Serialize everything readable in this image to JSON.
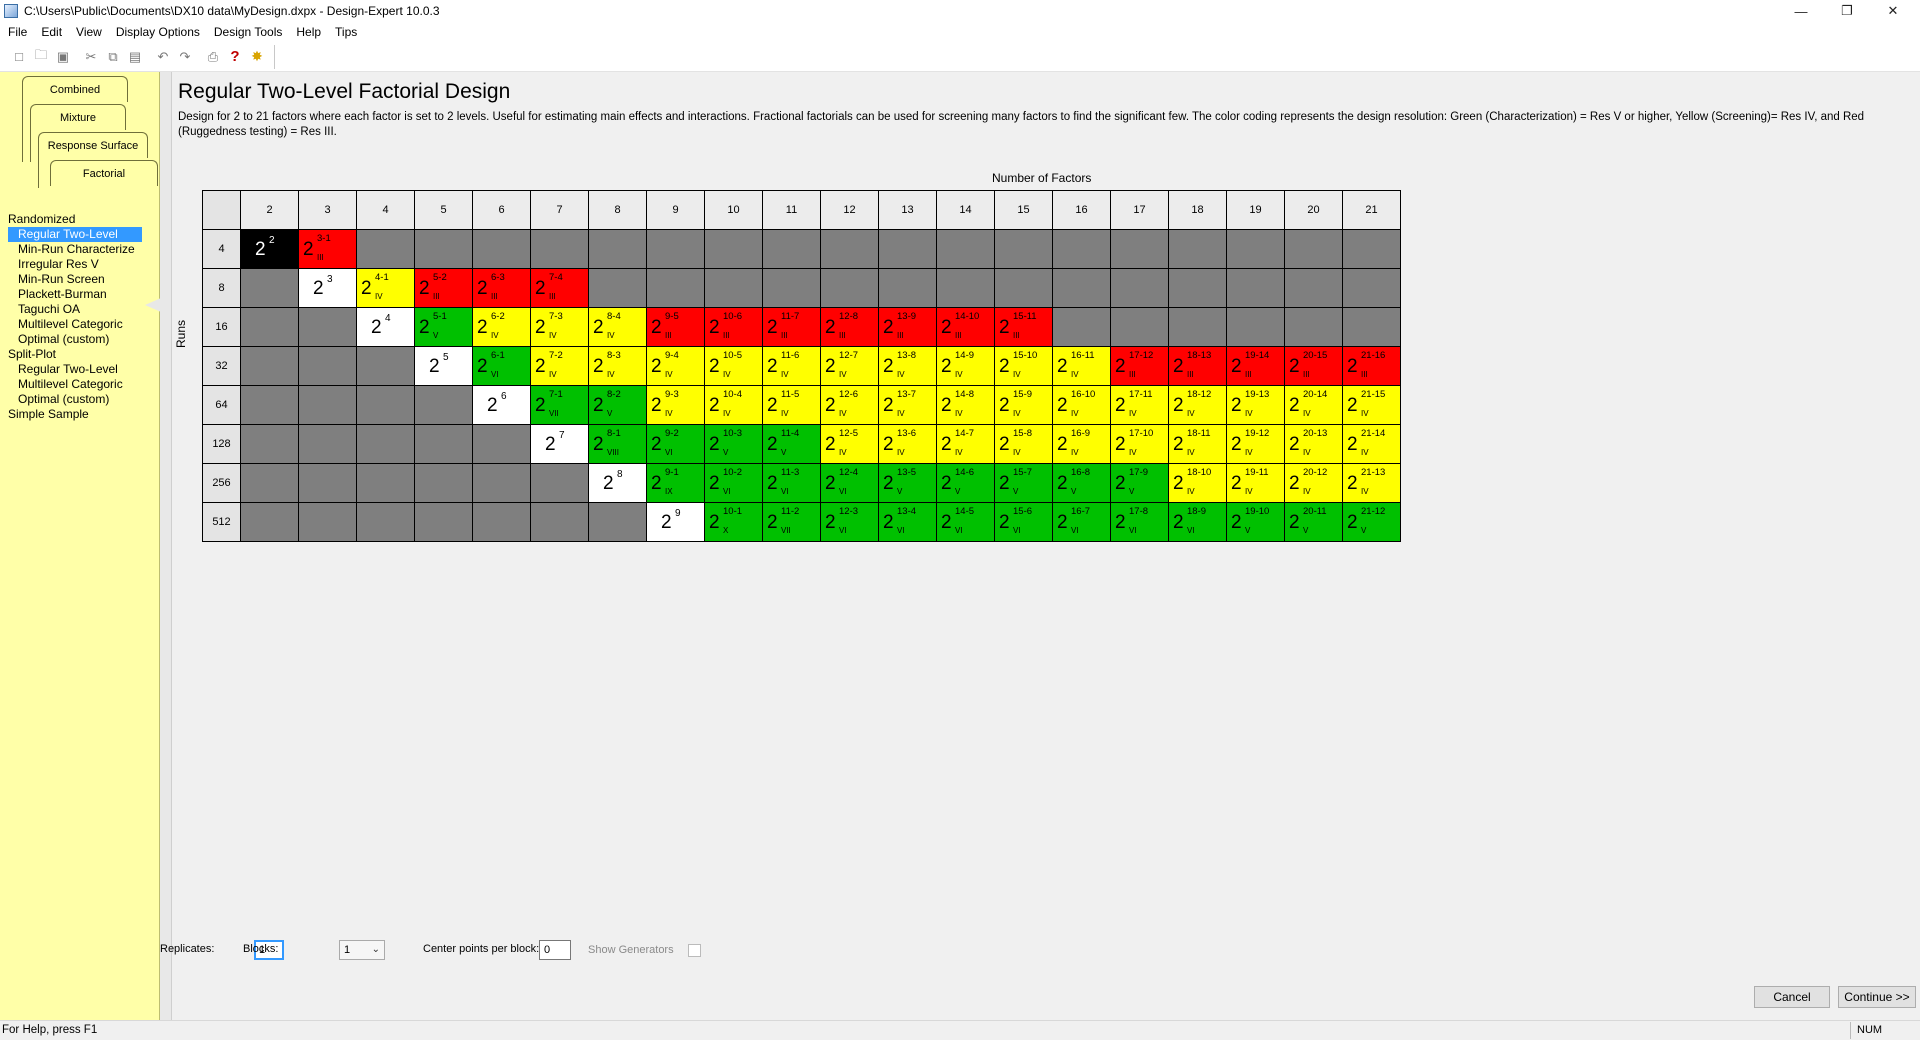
{
  "window": {
    "title": "C:\\Users\\Public\\Documents\\DX10 data\\MyDesign.dxpx - Design-Expert 10.0.3",
    "controls": [
      "—",
      "❐",
      "✕"
    ]
  },
  "menu": [
    "File",
    "Edit",
    "View",
    "Display Options",
    "Design Tools",
    "Help",
    "Tips"
  ],
  "toolbar": {
    "icons": [
      "new-file-icon",
      "open-folder-icon",
      "save-icon",
      "cut-icon",
      "copy-icon",
      "paste-icon",
      "undo-icon",
      "redo-icon",
      "print-icon",
      "help-icon",
      "tip-bulb-icon"
    ]
  },
  "left_panel": {
    "tabs": [
      "Combined",
      "Mixture",
      "Response Surface",
      "Factorial"
    ],
    "groups": [
      {
        "label": "Randomized",
        "items": [
          "Regular Two-Level",
          "Min-Run Characterize",
          "Irregular Res V",
          "Min-Run Screen",
          "Plackett-Burman",
          "Taguchi OA",
          "Multilevel Categoric",
          "Optimal (custom)"
        ]
      },
      {
        "label": "Split-Plot",
        "items": [
          "Regular Two-Level",
          "Multilevel Categoric",
          "Optimal (custom)"
        ]
      },
      {
        "label": "Simple Sample",
        "items": []
      }
    ],
    "selected": "Regular Two-Level"
  },
  "main": {
    "title": "Regular Two-Level Factorial Design",
    "description": "Design for 2 to 21 factors where each factor is set to 2 levels. Useful for estimating main effects and interactions. Fractional factorials can be used for screening many factors to find the significant few. The color coding represents the design resolution: Green (Characterization) = Res V or higher, Yellow (Screening)= Res IV, and Red (Ruggedness testing) = Res III.",
    "x_axis_label": "Number of Factors",
    "y_axis_label": "Runs"
  },
  "colors": {
    "gray": "#7f7f7f",
    "white": "#ffffff",
    "black": "#000000",
    "red": "#ff0000",
    "yellow": "#ffff00",
    "green": "#00c000"
  },
  "design_table": {
    "factors": [
      2,
      3,
      4,
      5,
      6,
      7,
      8,
      9,
      10,
      11,
      12,
      13,
      14,
      15,
      16,
      17,
      18,
      19,
      20,
      21
    ],
    "runs": [
      4,
      8,
      16,
      32,
      64,
      128,
      256,
      512
    ],
    "rows": [
      [
        {
          "e": "2",
          "c": "black"
        },
        {
          "e": "3-1",
          "r": "III"
        },
        null,
        null,
        null,
        null,
        null,
        null,
        null,
        null,
        null,
        null,
        null,
        null,
        null,
        null,
        null,
        null,
        null,
        null
      ],
      [
        null,
        {
          "e": "3",
          "c": "white"
        },
        {
          "e": "4-1",
          "r": "IV"
        },
        {
          "e": "5-2",
          "r": "III"
        },
        {
          "e": "6-3",
          "r": "III"
        },
        {
          "e": "7-4",
          "r": "III"
        },
        null,
        null,
        null,
        null,
        null,
        null,
        null,
        null,
        null,
        null,
        null,
        null,
        null,
        null
      ],
      [
        null,
        null,
        {
          "e": "4",
          "c": "white"
        },
        {
          "e": "5-1",
          "r": "V"
        },
        {
          "e": "6-2",
          "r": "IV"
        },
        {
          "e": "7-3",
          "r": "IV"
        },
        {
          "e": "8-4",
          "r": "IV"
        },
        {
          "e": "9-5",
          "r": "III"
        },
        {
          "e": "10-6",
          "r": "III"
        },
        {
          "e": "11-7",
          "r": "III"
        },
        {
          "e": "12-8",
          "r": "III"
        },
        {
          "e": "13-9",
          "r": "III"
        },
        {
          "e": "14-10",
          "r": "III"
        },
        {
          "e": "15-11",
          "r": "III"
        },
        null,
        null,
        null,
        null,
        null,
        null
      ],
      [
        null,
        null,
        null,
        {
          "e": "5",
          "c": "white"
        },
        {
          "e": "6-1",
          "r": "VI"
        },
        {
          "e": "7-2",
          "r": "IV"
        },
        {
          "e": "8-3",
          "r": "IV"
        },
        {
          "e": "9-4",
          "r": "IV"
        },
        {
          "e": "10-5",
          "r": "IV"
        },
        {
          "e": "11-6",
          "r": "IV"
        },
        {
          "e": "12-7",
          "r": "IV"
        },
        {
          "e": "13-8",
          "r": "IV"
        },
        {
          "e": "14-9",
          "r": "IV"
        },
        {
          "e": "15-10",
          "r": "IV"
        },
        {
          "e": "16-11",
          "r": "IV"
        },
        {
          "e": "17-12",
          "r": "III"
        },
        {
          "e": "18-13",
          "r": "III"
        },
        {
          "e": "19-14",
          "r": "III"
        },
        {
          "e": "20-15",
          "r": "III"
        },
        {
          "e": "21-16",
          "r": "III"
        }
      ],
      [
        null,
        null,
        null,
        null,
        {
          "e": "6",
          "c": "white"
        },
        {
          "e": "7-1",
          "r": "VII"
        },
        {
          "e": "8-2",
          "r": "V"
        },
        {
          "e": "9-3",
          "r": "IV"
        },
        {
          "e": "10-4",
          "r": "IV"
        },
        {
          "e": "11-5",
          "r": "IV"
        },
        {
          "e": "12-6",
          "r": "IV"
        },
        {
          "e": "13-7",
          "r": "IV"
        },
        {
          "e": "14-8",
          "r": "IV"
        },
        {
          "e": "15-9",
          "r": "IV"
        },
        {
          "e": "16-10",
          "r": "IV"
        },
        {
          "e": "17-11",
          "r": "IV"
        },
        {
          "e": "18-12",
          "r": "IV"
        },
        {
          "e": "19-13",
          "r": "IV"
        },
        {
          "e": "20-14",
          "r": "IV"
        },
        {
          "e": "21-15",
          "r": "IV"
        }
      ],
      [
        null,
        null,
        null,
        null,
        null,
        {
          "e": "7",
          "c": "white"
        },
        {
          "e": "8-1",
          "r": "VIII"
        },
        {
          "e": "9-2",
          "r": "VI"
        },
        {
          "e": "10-3",
          "r": "V"
        },
        {
          "e": "11-4",
          "r": "V"
        },
        {
          "e": "12-5",
          "r": "IV"
        },
        {
          "e": "13-6",
          "r": "IV"
        },
        {
          "e": "14-7",
          "r": "IV"
        },
        {
          "e": "15-8",
          "r": "IV"
        },
        {
          "e": "16-9",
          "r": "IV"
        },
        {
          "e": "17-10",
          "r": "IV"
        },
        {
          "e": "18-11",
          "r": "IV"
        },
        {
          "e": "19-12",
          "r": "IV"
        },
        {
          "e": "20-13",
          "r": "IV"
        },
        {
          "e": "21-14",
          "r": "IV"
        }
      ],
      [
        null,
        null,
        null,
        null,
        null,
        null,
        {
          "e": "8",
          "c": "white"
        },
        {
          "e": "9-1",
          "r": "IX"
        },
        {
          "e": "10-2",
          "r": "VI"
        },
        {
          "e": "11-3",
          "r": "VI"
        },
        {
          "e": "12-4",
          "r": "VI"
        },
        {
          "e": "13-5",
          "r": "V"
        },
        {
          "e": "14-6",
          "r": "V"
        },
        {
          "e": "15-7",
          "r": "V"
        },
        {
          "e": "16-8",
          "r": "V"
        },
        {
          "e": "17-9",
          "r": "V"
        },
        {
          "e": "18-10",
          "r": "IV"
        },
        {
          "e": "19-11",
          "r": "IV"
        },
        {
          "e": "20-12",
          "r": "IV"
        },
        {
          "e": "21-13",
          "r": "IV"
        }
      ],
      [
        null,
        null,
        null,
        null,
        null,
        null,
        null,
        {
          "e": "9",
          "c": "white"
        },
        {
          "e": "10-1",
          "r": "X"
        },
        {
          "e": "11-2",
          "r": "VII"
        },
        {
          "e": "12-3",
          "r": "VI"
        },
        {
          "e": "13-4",
          "r": "VI"
        },
        {
          "e": "14-5",
          "r": "VI"
        },
        {
          "e": "15-6",
          "r": "VI"
        },
        {
          "e": "16-7",
          "r": "VI"
        },
        {
          "e": "17-8",
          "r": "VI"
        },
        {
          "e": "18-9",
          "r": "VI"
        },
        {
          "e": "19-10",
          "r": "V"
        },
        {
          "e": "20-11",
          "r": "V"
        },
        {
          "e": "21-12",
          "r": "V"
        }
      ]
    ]
  },
  "controls": {
    "replicates_label": "Replicates:",
    "replicates_value": "1",
    "blocks_label": "Blocks:",
    "blocks_value": "1",
    "center_label": "Center points per block:",
    "center_value": "0",
    "generators_label": "Show Generators"
  },
  "buttons": {
    "cancel": "Cancel",
    "continue": "Continue >>"
  },
  "status": {
    "text": "For Help, press F1",
    "num": "NUM"
  }
}
